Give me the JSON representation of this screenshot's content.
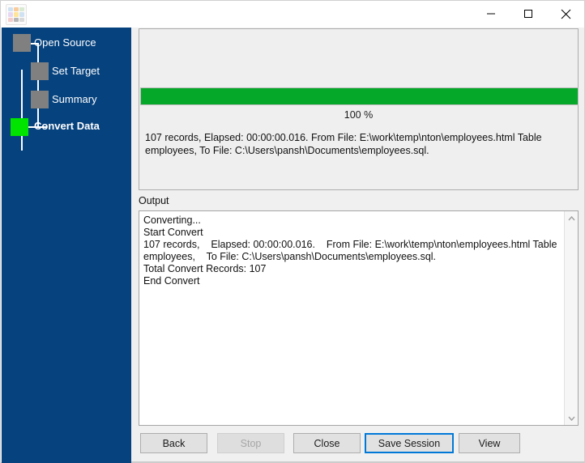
{
  "window": {
    "title": "",
    "app_icon": "app-grid-icon",
    "controls": {
      "minimize": "minimize-icon",
      "maximize": "maximize-icon",
      "close": "close-icon"
    }
  },
  "colors": {
    "sidebar_bg": "#06427e",
    "step_inactive": "#808080",
    "step_active": "#00e400",
    "progress_fill": "#06a82a",
    "focus_border": "#0078d7",
    "panel_bg": "#efefef"
  },
  "sidebar": {
    "steps": [
      {
        "label": "Open Source",
        "active": false
      },
      {
        "label": "Set Target",
        "active": false
      },
      {
        "label": "Summary",
        "active": false
      },
      {
        "label": "Convert Data",
        "active": true
      }
    ]
  },
  "progress": {
    "percent": 100,
    "percent_label": "100 %",
    "status_line": "107 records,    Elapsed: 00:00:00.016.    From File: E:\\work\\temp\\nton\\employees.html Table employees, To File: C:\\Users\\pansh\\Documents\\employees.sql."
  },
  "output": {
    "label": "Output",
    "text": "Converting...\nStart Convert\n107 records,    Elapsed: 00:00:00.016.    From File: E:\\work\\temp\\nton\\employees.html Table employees,    To File: C:\\Users\\pansh\\Documents\\employees.sql.\nTotal Convert Records: 107\nEnd Convert",
    "scrollbar": {
      "up_arrow": "chevron-up-icon",
      "down_arrow": "chevron-down-icon"
    }
  },
  "buttons": [
    {
      "label": "Back",
      "state": "enabled"
    },
    {
      "label": "Stop",
      "state": "disabled"
    },
    {
      "label": "Close",
      "state": "enabled"
    },
    {
      "label": "Save Session",
      "state": "focused"
    },
    {
      "label": "View",
      "state": "enabled"
    }
  ]
}
